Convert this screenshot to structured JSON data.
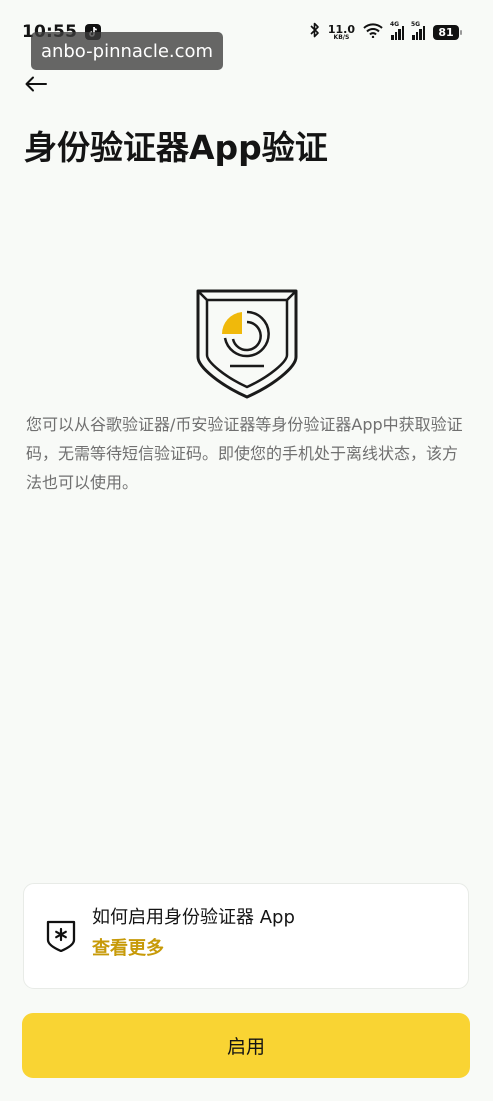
{
  "status_bar": {
    "time": "10:55",
    "net_speed_value": "11.0",
    "net_speed_unit": "KB/S",
    "signal_1_label": "4G",
    "signal_2_label": "5G",
    "battery": "81"
  },
  "watermark": "anbo-pinnacle.com",
  "header": {
    "back_icon": "back-arrow-icon",
    "title": "身份验证器App验证"
  },
  "illustration": {
    "icon": "authenticator-shield-icon",
    "accent_color": "#f0b90b"
  },
  "description": "您可以从谷歌验证器/币安验证器等身份验证器App中获取验证码，无需等待短信验证码。即使您的手机处于离线状态，该方法也可以使用。",
  "help_card": {
    "icon": "shield-asterisk-icon",
    "title": "如何启用身份验证器 App",
    "link": "查看更多",
    "link_color": "#c79a08"
  },
  "primary_button": {
    "label": "启用",
    "color": "#f9d433"
  }
}
